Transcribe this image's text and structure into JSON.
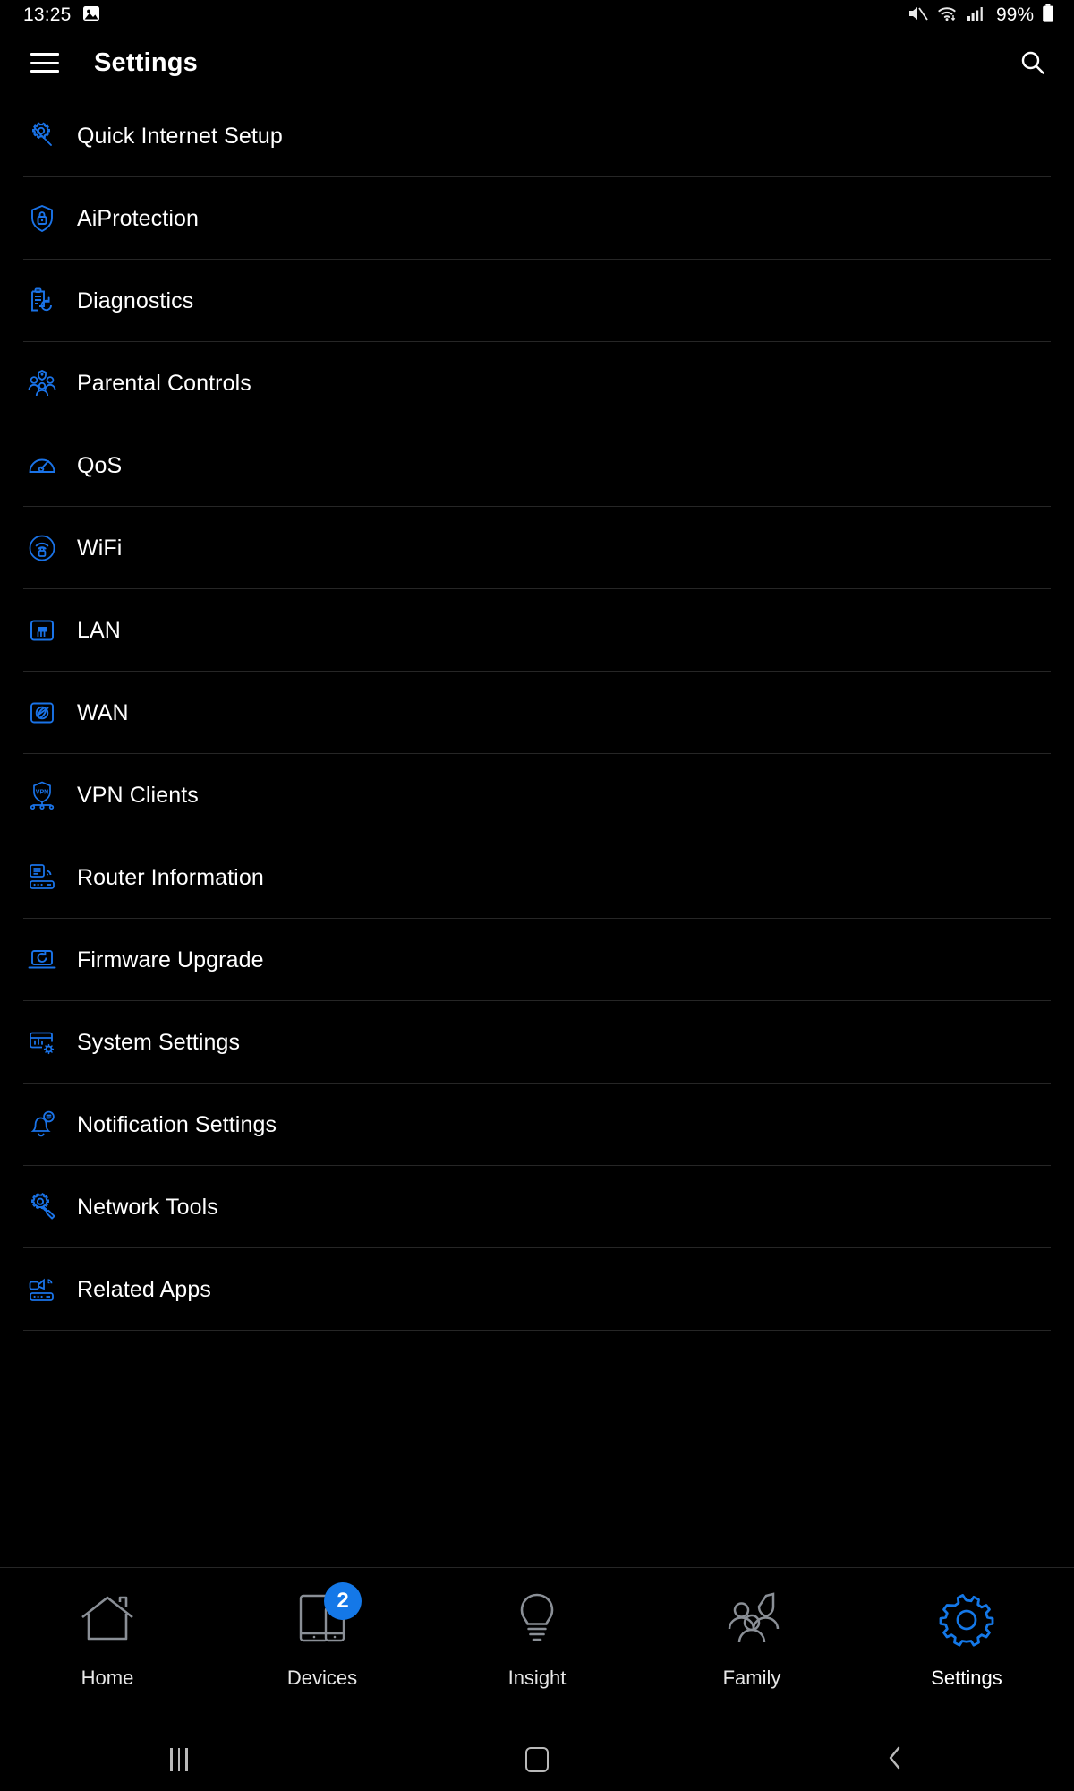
{
  "status_bar": {
    "time": "13:25",
    "left_icons": [
      "image-icon"
    ],
    "right_icons": [
      "mute-icon",
      "wifi-icon",
      "cellular-signal-icon"
    ],
    "battery_percent": "99%",
    "battery_icon": "battery-full-icon"
  },
  "app_bar": {
    "menu_icon": "hamburger-menu-icon",
    "title": "Settings",
    "search_icon": "search-icon"
  },
  "settings_list": [
    {
      "label": "Quick Internet Setup",
      "icon": "gear-wand-icon"
    },
    {
      "label": "AiProtection",
      "icon": "shield-lock-icon"
    },
    {
      "label": "Diagnostics",
      "icon": "clipboard-refresh-icon"
    },
    {
      "label": "Parental Controls",
      "icon": "family-group-icon"
    },
    {
      "label": "QoS",
      "icon": "speedometer-icon"
    },
    {
      "label": "WiFi",
      "icon": "wifi-lock-icon"
    },
    {
      "label": "LAN",
      "icon": "ethernet-port-icon"
    },
    {
      "label": "WAN",
      "icon": "globe-square-icon"
    },
    {
      "label": "VPN Clients",
      "icon": "vpn-shield-nodes-icon"
    },
    {
      "label": "Router Information",
      "icon": "router-info-icon"
    },
    {
      "label": "Firmware Upgrade",
      "icon": "laptop-refresh-icon"
    },
    {
      "label": "System Settings",
      "icon": "panel-gear-icon"
    },
    {
      "label": "Notification Settings",
      "icon": "bell-message-icon"
    },
    {
      "label": "Network Tools",
      "icon": "gear-wrench-icon"
    },
    {
      "label": "Related Apps",
      "icon": "router-devices-icon"
    }
  ],
  "bottom_tabs": [
    {
      "label": "Home",
      "icon": "home-icon",
      "active": false,
      "badge": null
    },
    {
      "label": "Devices",
      "icon": "devices-icon",
      "active": false,
      "badge": "2"
    },
    {
      "label": "Insight",
      "icon": "bulb-icon",
      "active": false,
      "badge": null
    },
    {
      "label": "Family",
      "icon": "family-icon",
      "active": false,
      "badge": null
    },
    {
      "label": "Settings",
      "icon": "gear-icon",
      "active": true,
      "badge": null
    }
  ],
  "system_nav": {
    "recents_label": "recents-button",
    "home_label": "home-button",
    "back_label": "back-button"
  },
  "colors": {
    "background": "#000000",
    "accent_blue": "#1478e8",
    "icon_blue": "#1a73e8",
    "divider": "#262626",
    "inactive_tab": "#8a8f96"
  }
}
